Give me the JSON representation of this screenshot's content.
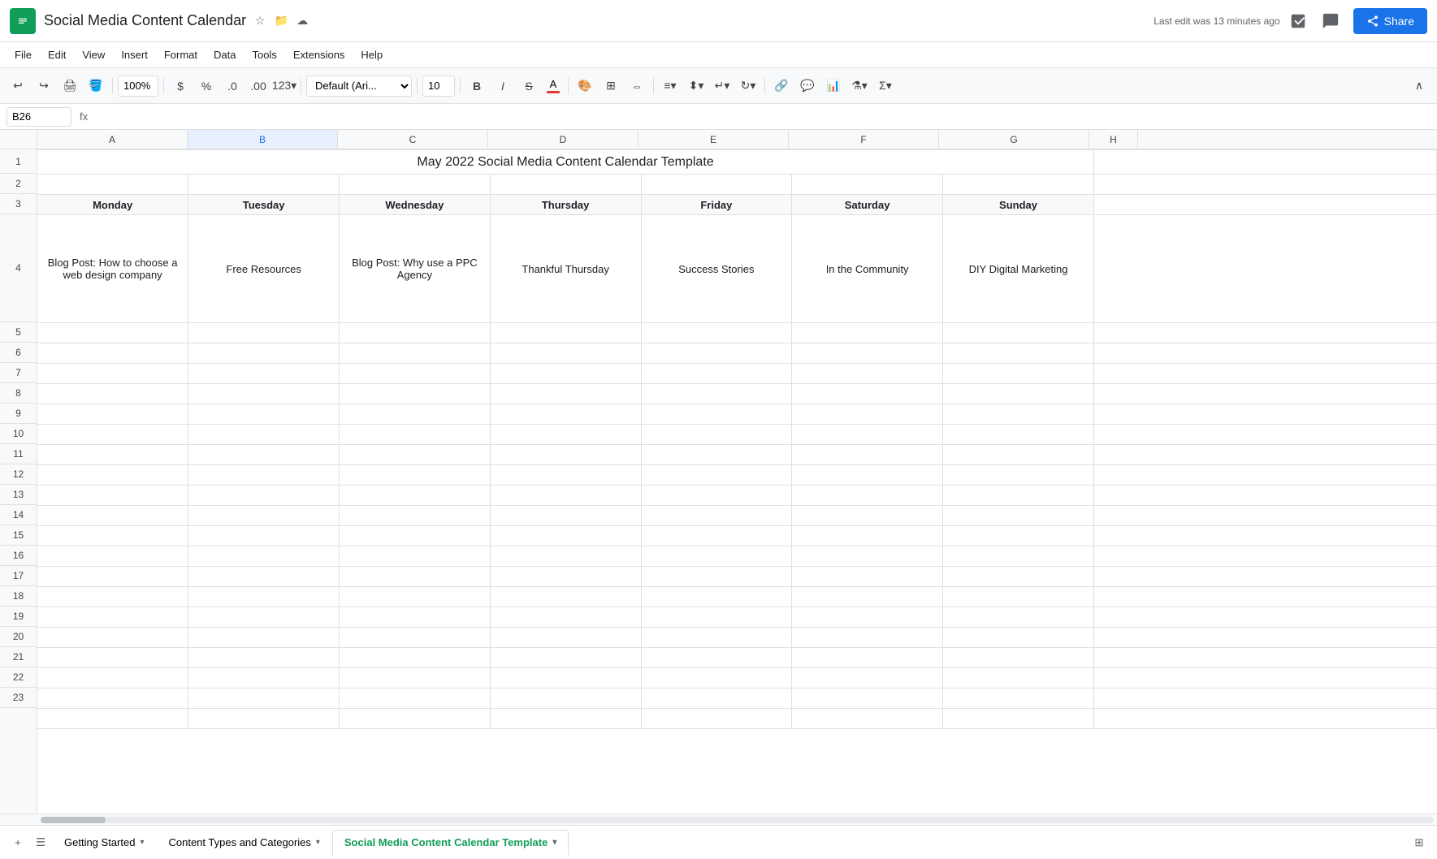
{
  "app": {
    "icon_color": "#0F9D58",
    "title": "Social Media Content Calendar",
    "last_edit": "Last edit was 13 minutes ago",
    "share_label": "Share"
  },
  "menu": {
    "items": [
      "File",
      "Edit",
      "View",
      "Insert",
      "Format",
      "Data",
      "Tools",
      "Extensions",
      "Help"
    ]
  },
  "toolbar": {
    "zoom": "100%",
    "currency": "$",
    "percent": "%",
    "decimal_less": ".0",
    "decimal_more": ".00",
    "format_number": "123",
    "font": "Default (Ari...",
    "font_size": "10",
    "bold": "B",
    "italic": "I",
    "strikethrough": "S"
  },
  "formula_bar": {
    "cell_ref": "B26",
    "fx": "fx"
  },
  "spreadsheet": {
    "title": "May 2022 Social Media Content Calendar Template",
    "columns": {
      "headers": [
        "A",
        "B",
        "C",
        "D",
        "E",
        "F",
        "G",
        "H"
      ],
      "widths": [
        "185px",
        "185px",
        "185px",
        "185px",
        "185px",
        "185px",
        "185px",
        "185px"
      ]
    },
    "row3_headers": [
      "Monday",
      "Tuesday",
      "Wednesday",
      "Thursday",
      "Friday",
      "Saturday",
      "Sunday"
    ],
    "row4_content": [
      "Blog Post: How to choose a web design company",
      "Free Resources",
      "Blog Post: Why use a PPC Agency",
      "Thankful Thursday",
      "Success Stories",
      "In the Community",
      "DIY Digital Marketing"
    ],
    "row_numbers": [
      "1",
      "2",
      "3",
      "4",
      "5",
      "6",
      "7",
      "8",
      "9",
      "10",
      "11",
      "12",
      "13",
      "14",
      "15",
      "16",
      "17",
      "18",
      "19",
      "20",
      "21",
      "22",
      "23"
    ]
  },
  "tabs": {
    "add_label": "+",
    "menu_label": "≡",
    "sheets": [
      {
        "label": "Getting Started",
        "active": false
      },
      {
        "label": "Content Types and Categories",
        "active": false
      },
      {
        "label": "Social Media Content Calendar Template",
        "active": true
      }
    ]
  }
}
